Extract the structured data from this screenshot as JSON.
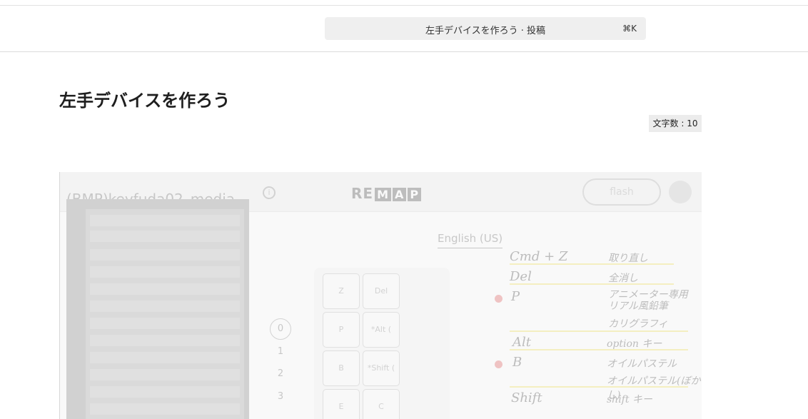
{
  "header": {
    "search_label": "左手デバイスを作ろう · 投稿",
    "search_shortcut": "⌘K"
  },
  "post": {
    "title": "左手デバイスを作ろう",
    "char_count": "文字数 : 10"
  },
  "media": {
    "document_name": "(BMP)keyfuda02_media",
    "logo_prefix": "RE",
    "logo_letters": [
      "M",
      "A",
      "P"
    ],
    "flash_label": "flash",
    "language": "English (US)",
    "layers": [
      "0",
      "1",
      "2",
      "3"
    ],
    "keys": [
      "Z",
      "Del",
      "P",
      "*Alt (",
      "B",
      "*Shift (",
      "E",
      "C"
    ],
    "notes": [
      {
        "key": "Cmd + Z",
        "desc": "取り直し"
      },
      {
        "key": "Del",
        "desc": "全消し"
      },
      {
        "key": "P",
        "desc": "アニメーター専用 リアル風鉛筆"
      },
      {
        "key": "",
        "desc": "カリグラフィ"
      },
      {
        "key": "Alt",
        "desc": "option キー"
      },
      {
        "key": "B",
        "desc": "オイルパステル"
      },
      {
        "key": "",
        "desc": "オイルパステル(ぼかし)"
      },
      {
        "key": "Shift",
        "desc": "shift キー"
      }
    ]
  }
}
